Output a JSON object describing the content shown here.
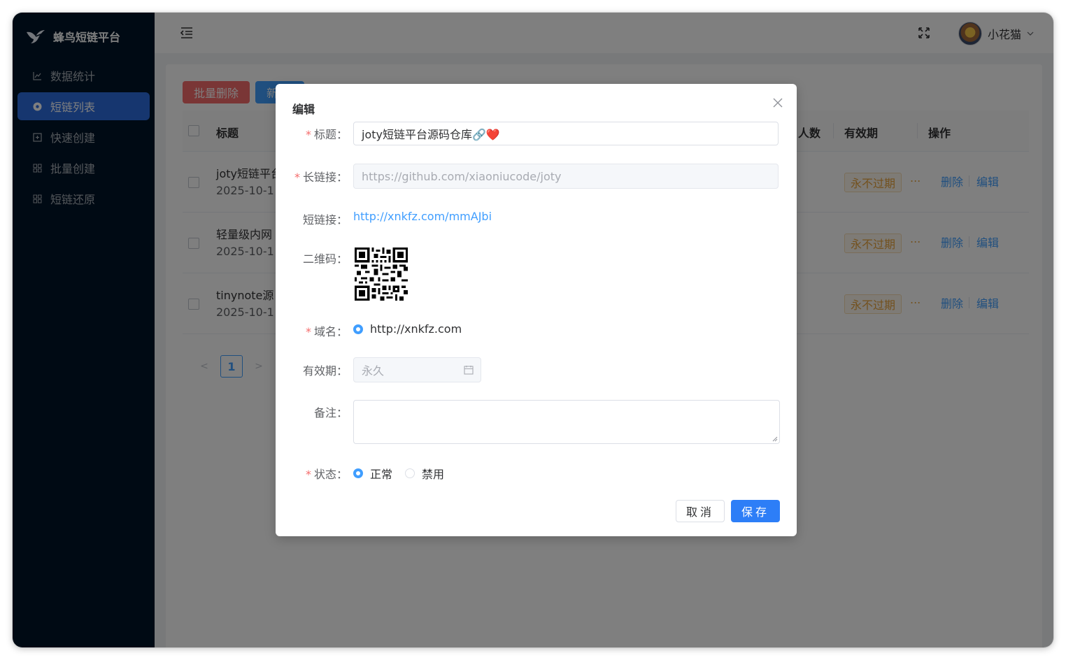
{
  "brand": {
    "name": "蜂鸟短链平台",
    "logo_icon": "hummingbird-icon"
  },
  "sidebar": {
    "items": [
      {
        "label": "数据统计",
        "icon": "chart-icon",
        "active": false
      },
      {
        "label": "短链列表",
        "icon": "link-list-icon",
        "active": true
      },
      {
        "label": "快速创建",
        "icon": "plus-square-icon",
        "active": false
      },
      {
        "label": "批量创建",
        "icon": "grid-icon",
        "active": false
      },
      {
        "label": "短链还原",
        "icon": "grid-icon",
        "active": false
      }
    ]
  },
  "header": {
    "user_name": "小花猫"
  },
  "toolbar": {
    "batch_delete_label": "批量删除",
    "new_label_partial": "新"
  },
  "table": {
    "columns": {
      "title": "标题",
      "visitors_partial": "人数",
      "validity": "有效期",
      "actions": "操作"
    },
    "rows": [
      {
        "title": "joty短链平台",
        "date": "2025-10-1",
        "validity": "永不过期",
        "more": "...",
        "delete": "删除",
        "edit": "编辑"
      },
      {
        "title": "轻量级内网",
        "date": "2025-10-1",
        "validity": "永不过期",
        "more": "...",
        "delete": "删除",
        "edit": "编辑"
      },
      {
        "title": "tinynote源",
        "date": "2025-10-1",
        "validity": "永不过期",
        "more": "...",
        "delete": "删除",
        "edit": "编辑"
      }
    ]
  },
  "pagination": {
    "current_page": "1",
    "prev": "<",
    "next": ">"
  },
  "dialog": {
    "title": "编辑",
    "fields": {
      "title_label": "标题：",
      "title_value": "joty短链平台源码仓库🔗❤️",
      "long_link_label": "长链接：",
      "long_link_value": "https://github.com/xiaoniucode/joty",
      "short_link_label": "短链接：",
      "short_link_value": "http://xnkfz.com/mmAJbi",
      "qrcode_label": "二维码：",
      "domain_label": "域名：",
      "domain_option": "http://xnkfz.com",
      "validity_label": "有效期：",
      "validity_placeholder": "永久",
      "remark_label": "备注：",
      "remark_value": "",
      "status_label": "状态：",
      "status_options": [
        "正常",
        "禁用"
      ],
      "status_selected": "正常"
    },
    "cancel_label": "取消",
    "save_label": "保存"
  },
  "colors": {
    "sidebar_bg": "#001529",
    "menu_active": "#2d6cdf",
    "primary": "#409eff",
    "danger": "#f56c6c",
    "warning": "#e6a23c"
  }
}
